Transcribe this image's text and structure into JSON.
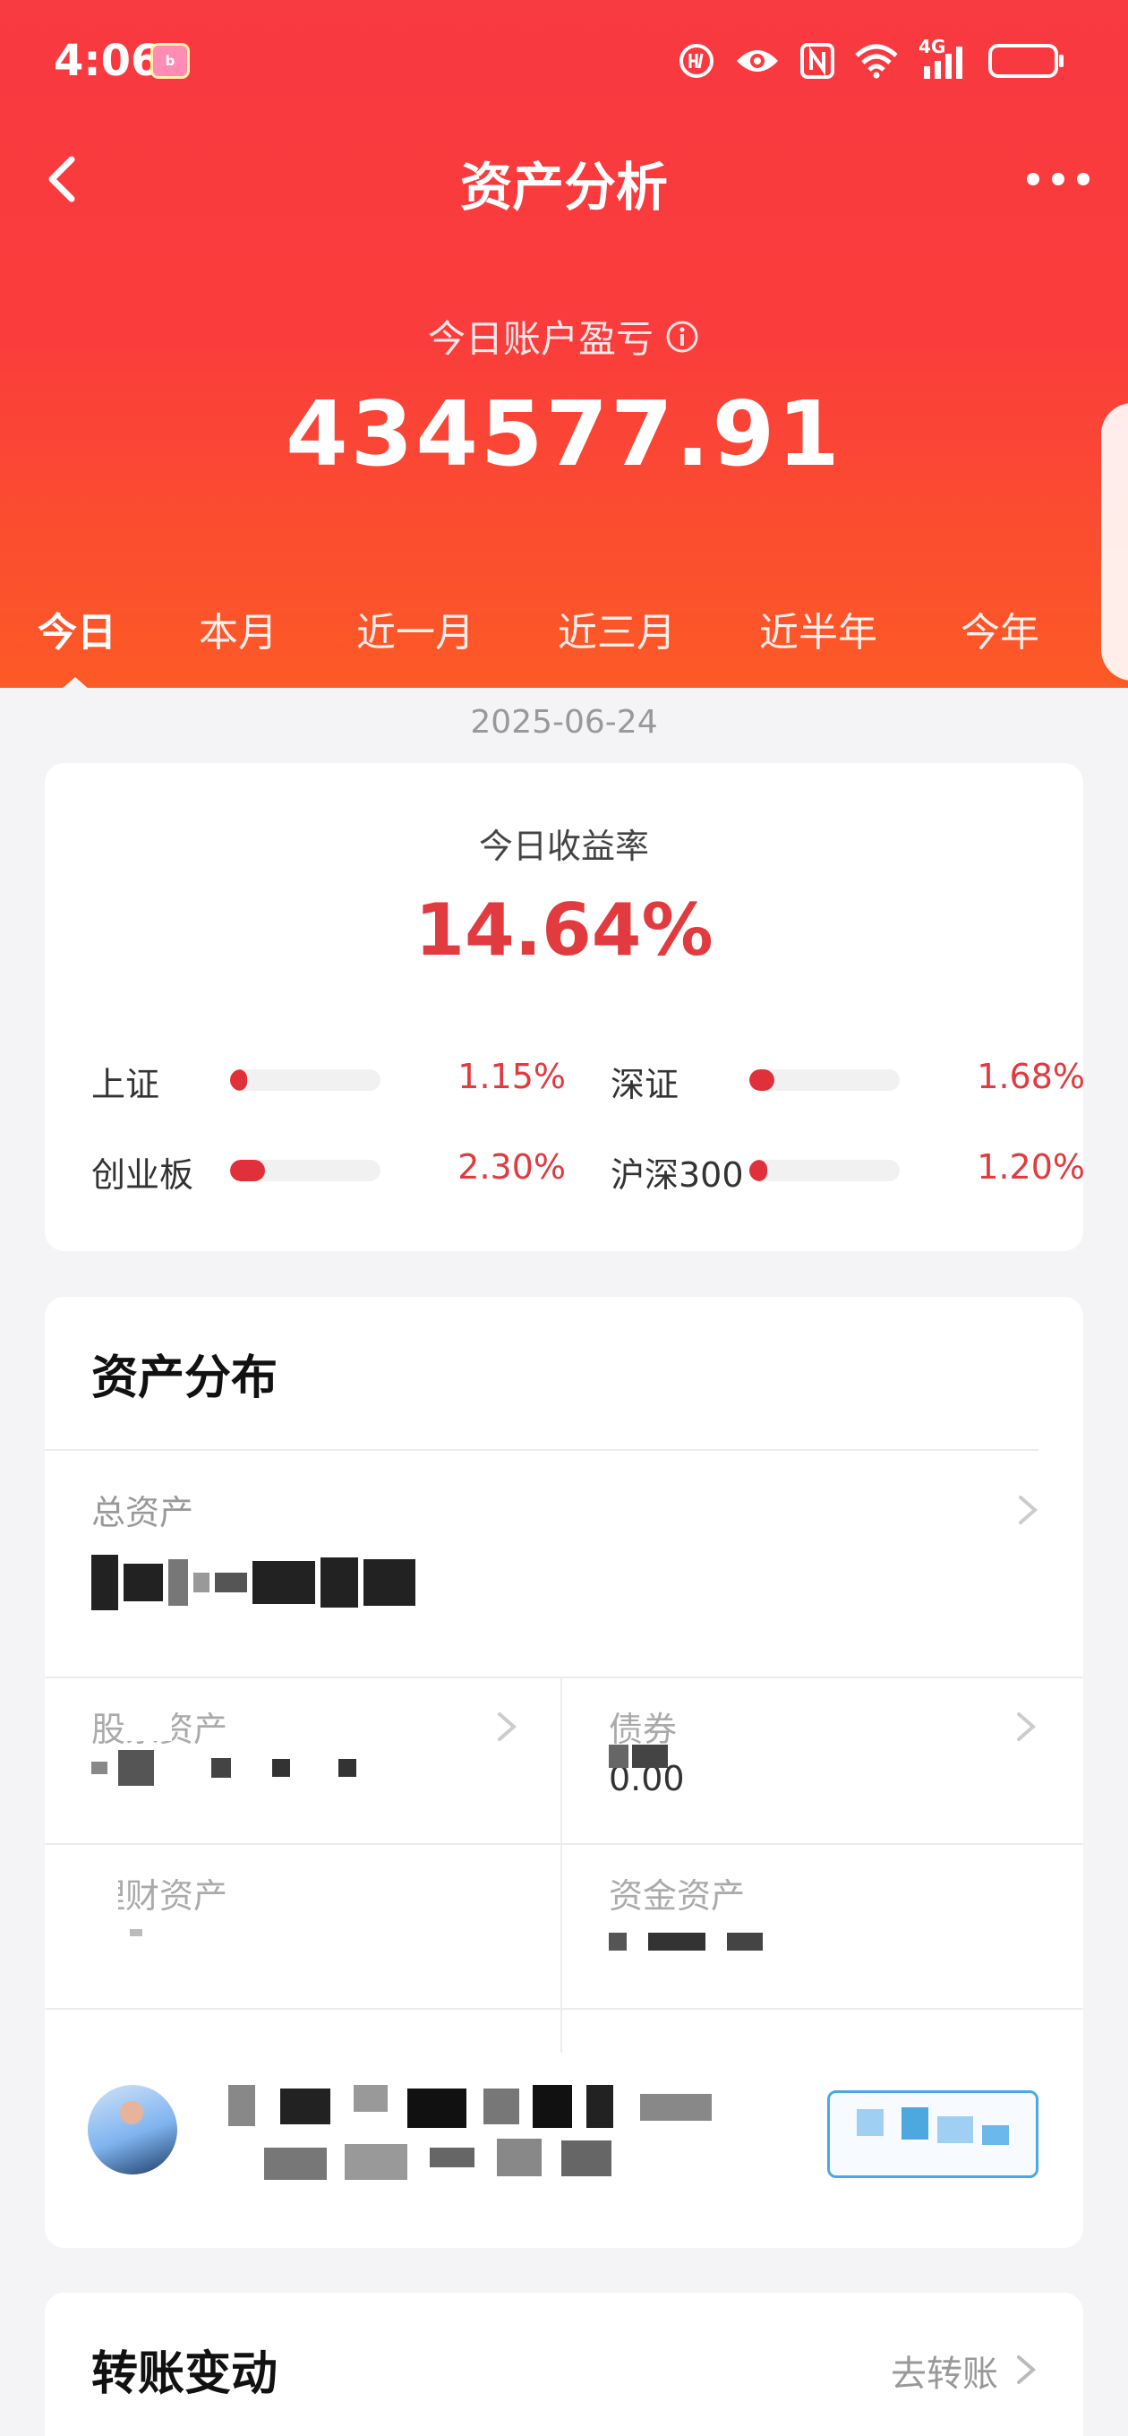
{
  "status_bar": {
    "time": "4:06",
    "app_badge": "bilibili",
    "network": "4G"
  },
  "header": {
    "title": "资产分析"
  },
  "summary": {
    "profit_label": "今日账户盈亏",
    "profit_value": "434577.91"
  },
  "period_tabs": [
    {
      "label": "今日",
      "active": true
    },
    {
      "label": "本月",
      "active": false
    },
    {
      "label": "近一月",
      "active": false
    },
    {
      "label": "近三月",
      "active": false
    },
    {
      "label": "近半年",
      "active": false
    },
    {
      "label": "今年",
      "active": false
    }
  ],
  "date": "2025-06-24",
  "return_card": {
    "label": "今日收益率",
    "value": "14.64%",
    "indices": [
      {
        "name": "上证",
        "value": "1.15%",
        "fill": 0.0115
      },
      {
        "name": "深证",
        "value": "1.68%",
        "fill": 0.0168
      },
      {
        "name": "创业板",
        "value": "2.30%",
        "fill": 0.023
      },
      {
        "name": "沪深300",
        "value": "1.20%",
        "fill": 0.012
      }
    ]
  },
  "distribution": {
    "title": "资产分布",
    "total_label": "总资产",
    "cells": [
      {
        "label": "股票资产"
      },
      {
        "label": "债券",
        "value": "0.00"
      },
      {
        "label": "理财资产"
      },
      {
        "label": "资金资产"
      }
    ]
  },
  "transfer": {
    "title": "转账变动",
    "link": "去转账"
  },
  "colors": {
    "header_red": "#f83a41",
    "header_orange": "#fc5a26",
    "up_red": "#e13a3f",
    "background": "#f4f4f6"
  }
}
